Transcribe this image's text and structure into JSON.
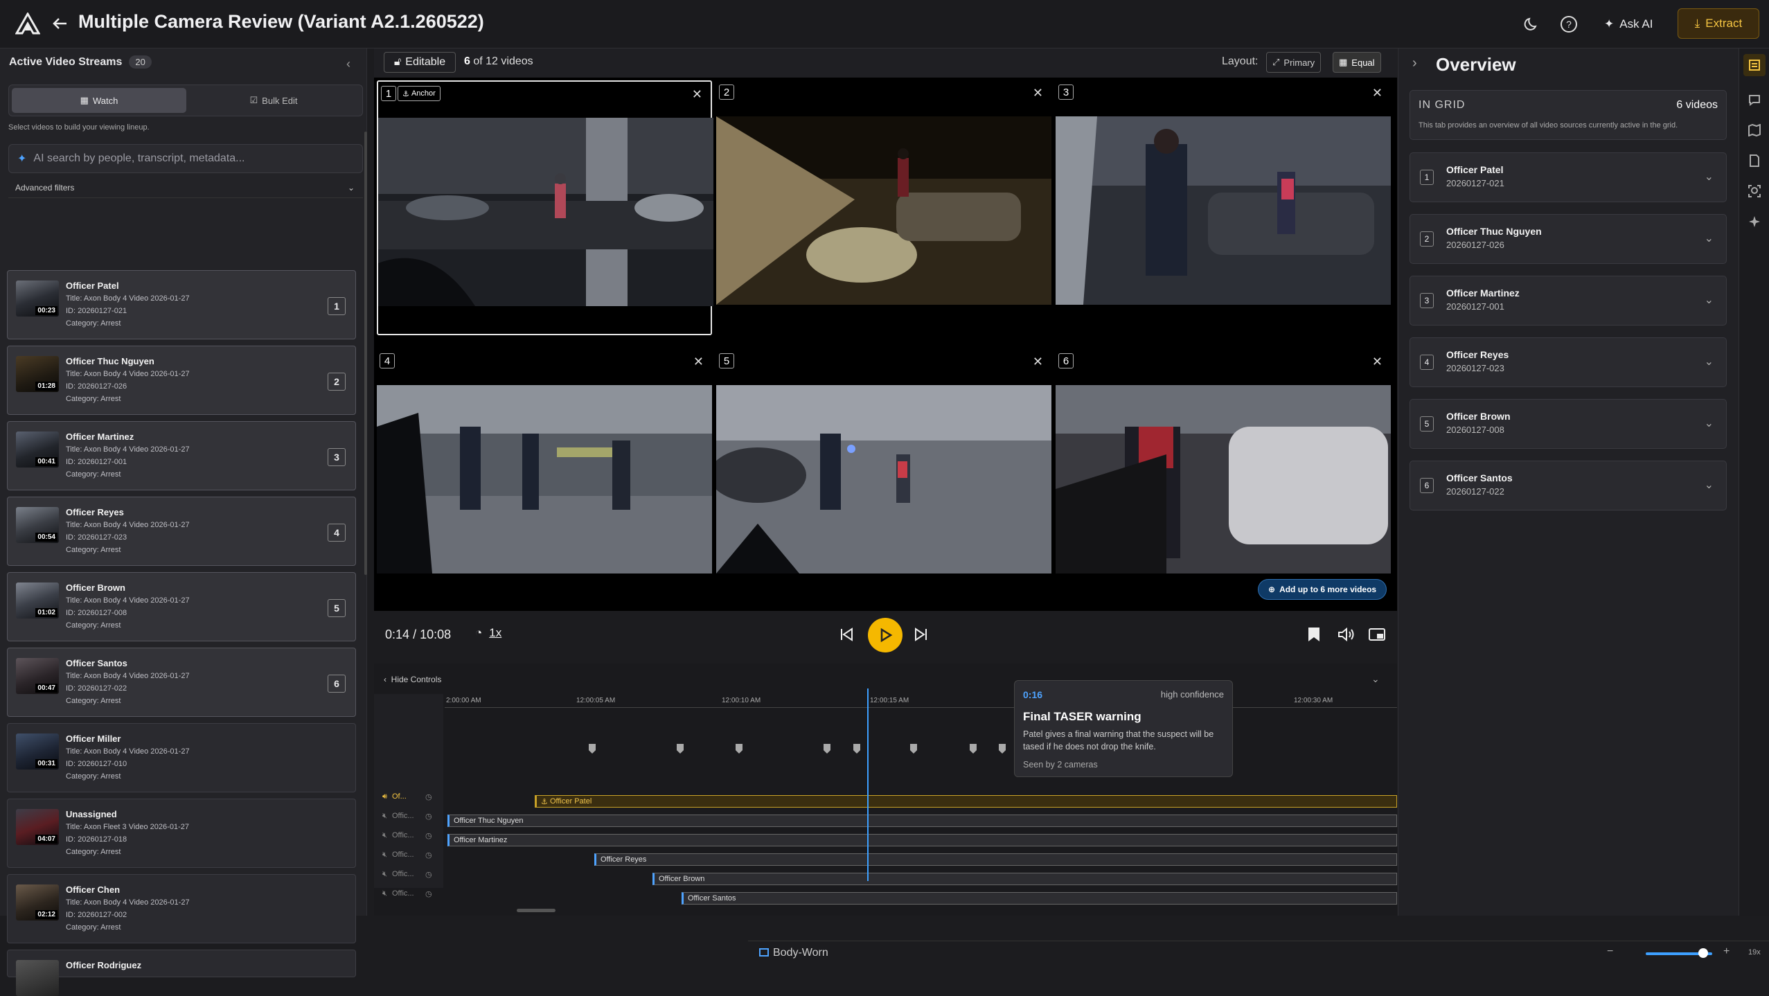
{
  "app": {
    "title": "Multiple Camera Review (Variant A2.1.260522)",
    "ask_ai": "Ask AI",
    "extract": "Extract"
  },
  "sidebar": {
    "title": "Active Video Streams",
    "count": "20",
    "tabs": {
      "watch": "Watch",
      "bulk": "Bulk Edit"
    },
    "hint": "Select videos to build your viewing lineup.",
    "search_placeholder": "AI search by people, transcript, metadata...",
    "advanced": "Advanced filters",
    "videos": [
      {
        "name": "Officer Patel",
        "title": "Title: Axon Body 4 Video 2026-01-27",
        "id": "ID: 20260127-021",
        "category": "Category: Arrest",
        "duration": "00:23",
        "slot": "1"
      },
      {
        "name": "Officer Thuc Nguyen",
        "title": "Title: Axon Body 4 Video 2026-01-27",
        "id": "ID: 20260127-026",
        "category": "Category: Arrest",
        "duration": "01:28",
        "slot": "2"
      },
      {
        "name": "Officer Martinez",
        "title": "Title: Axon Body 4 Video 2026-01-27",
        "id": "ID: 20260127-001",
        "category": "Category: Arrest",
        "duration": "00:41",
        "slot": "3"
      },
      {
        "name": "Officer Reyes",
        "title": "Title: Axon Body 4 Video 2026-01-27",
        "id": "ID: 20260127-023",
        "category": "Category: Arrest",
        "duration": "00:54",
        "slot": "4"
      },
      {
        "name": "Officer Brown",
        "title": "Title: Axon Body 4 Video 2026-01-27",
        "id": "ID: 20260127-008",
        "category": "Category: Arrest",
        "duration": "01:02",
        "slot": "5"
      },
      {
        "name": "Officer Santos",
        "title": "Title: Axon Body 4 Video 2026-01-27",
        "id": "ID: 20260127-022",
        "category": "Category: Arrest",
        "duration": "00:47",
        "slot": "6"
      },
      {
        "name": "Officer Miller",
        "title": "Title: Axon Body 4 Video 2026-01-27",
        "id": "ID: 20260127-010",
        "category": "Category: Arrest",
        "duration": "00:31",
        "slot": ""
      },
      {
        "name": "Unassigned",
        "title": "Title: Axon Fleet 3 Video 2026-01-27",
        "id": "ID: 20260127-018",
        "category": "Category: Arrest",
        "duration": "04:07",
        "slot": ""
      },
      {
        "name": "Officer Chen",
        "title": "Title: Axon Body 4 Video 2026-01-27",
        "id": "ID: 20260127-002",
        "category": "Category: Arrest",
        "duration": "02:12",
        "slot": ""
      },
      {
        "name": "Officer Rodriguez",
        "title": "",
        "id": "",
        "category": "",
        "duration": "",
        "slot": ""
      }
    ]
  },
  "grid": {
    "editable": "Editable",
    "count_bold": "6",
    "count_rest": "of 12 videos",
    "layout_label": "Layout:",
    "layout_primary": "Primary",
    "layout_equal": "Equal",
    "anchor_label": "Anchor",
    "tiles": [
      "1",
      "2",
      "3",
      "4",
      "5",
      "6"
    ],
    "add_more": "Add up to 6 more videos"
  },
  "player": {
    "current": "0:14",
    "sep": "/",
    "total": "10:08",
    "speed": "1x"
  },
  "timeline": {
    "hide_controls": "Hide Controls",
    "ticks": [
      "2:00:00 AM",
      "12:00:05 AM",
      "12:00:10 AM",
      "12:00:15 AM",
      "12:00:30 AM"
    ],
    "tracks": [
      "Officer Patel",
      "Officer Thuc Nguyen",
      "Officer Martinez",
      "Officer Reyes",
      "Officer Brown",
      "Officer Santos"
    ],
    "row_labels": [
      "Of...",
      "Offic...",
      "Offic...",
      "Offic...",
      "Offic...",
      "Offic..."
    ],
    "footer": "Body-Worn",
    "zoom": "19x"
  },
  "tooltip": {
    "time": "0:16",
    "confidence": "high confidence",
    "title": "Final TASER warning",
    "body": "Patel gives a final warning that the suspect will be tased if he does not drop the knife.",
    "seen": "Seen by 2 cameras"
  },
  "overview": {
    "title": "Overview",
    "in_grid": "IN GRID",
    "videos": "6 videos",
    "desc": "This tab provides an overview of all video sources currently active in the grid.",
    "items": [
      {
        "num": "1",
        "name": "Officer Patel",
        "id": "20260127-021"
      },
      {
        "num": "2",
        "name": "Officer Thuc Nguyen",
        "id": "20260127-026"
      },
      {
        "num": "3",
        "name": "Officer Martinez",
        "id": "20260127-001"
      },
      {
        "num": "4",
        "name": "Officer Reyes",
        "id": "20260127-023"
      },
      {
        "num": "5",
        "name": "Officer Brown",
        "id": "20260127-008"
      },
      {
        "num": "6",
        "name": "Officer Santos",
        "id": "20260127-022"
      }
    ]
  },
  "colors": {
    "accent": "#f5b800",
    "link": "#3da0ff",
    "anchor_track": "#c9a227"
  }
}
